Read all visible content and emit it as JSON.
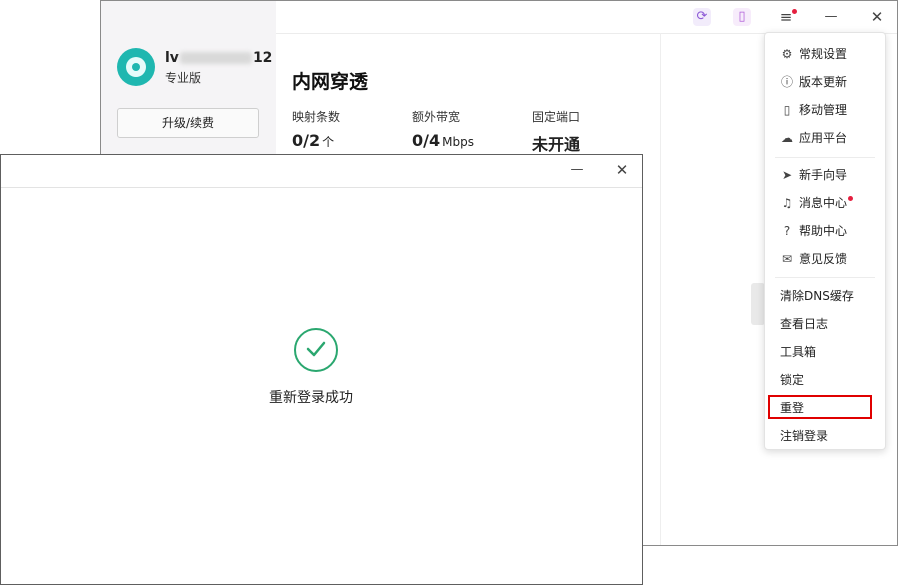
{
  "main_window": {
    "user": {
      "name_prefix": "lv",
      "name_suffix": "12",
      "edition": "专业版"
    },
    "upgrade_button": "升级/续费",
    "page_title": "内网穿透",
    "stats": [
      {
        "label": "映射条数",
        "value": "0/2",
        "unit": "个"
      },
      {
        "label": "额外带宽",
        "value": "0/4",
        "unit": "Mbps"
      },
      {
        "label": "固定端口",
        "value": "未开通",
        "unit": ""
      }
    ]
  },
  "menu": {
    "group1": [
      {
        "icon": "gear-icon",
        "label": "常规设置"
      },
      {
        "icon": "info-icon",
        "label": "版本更新"
      },
      {
        "icon": "phone-icon",
        "label": "移动管理"
      },
      {
        "icon": "cloud-icon",
        "label": "应用平台"
      }
    ],
    "group2": [
      {
        "icon": "navigation-icon",
        "label": "新手向导"
      },
      {
        "icon": "bell-icon",
        "label": "消息中心"
      },
      {
        "icon": "help-icon",
        "label": "帮助中心"
      },
      {
        "icon": "mail-icon",
        "label": "意见反馈"
      }
    ],
    "group3": [
      {
        "label": "清除DNS缓存"
      },
      {
        "label": "查看日志"
      },
      {
        "label": "工具箱"
      },
      {
        "label": "锁定"
      },
      {
        "label": "重登"
      },
      {
        "label": "注销登录"
      }
    ]
  },
  "dialog": {
    "message": "重新登录成功"
  },
  "colors": {
    "success": "#2aa76f",
    "highlight": "#e00000",
    "badge": "#e51f3f",
    "accent": "#1fb7b0"
  }
}
